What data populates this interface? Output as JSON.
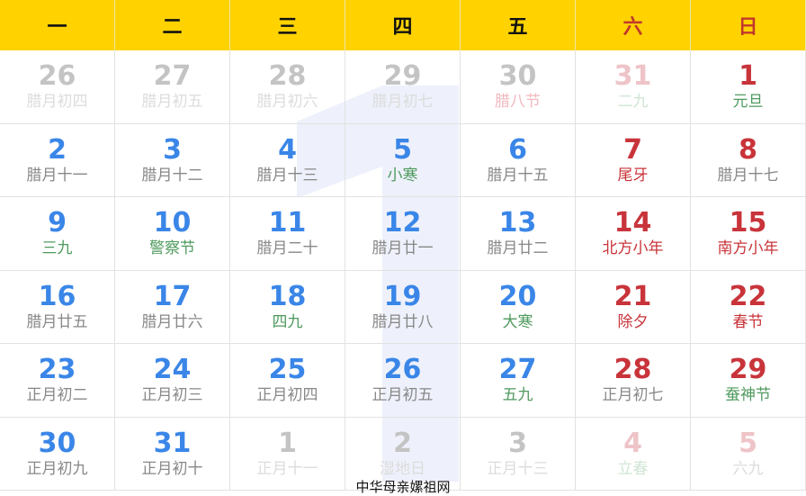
{
  "weekdays": [
    {
      "label": "一",
      "we": false
    },
    {
      "label": "二",
      "we": false
    },
    {
      "label": "三",
      "we": false
    },
    {
      "label": "四",
      "we": false
    },
    {
      "label": "五",
      "we": false
    },
    {
      "label": "六",
      "we": true
    },
    {
      "label": "日",
      "we": true
    }
  ],
  "watermark_month": "1",
  "colors": {
    "header": "#ffd200",
    "weekday_number": "#3a86e8",
    "weekend_number": "#c8343a",
    "term": "#4f9a5e"
  },
  "cells": [
    {
      "d": "26",
      "s": "腊月初四",
      "o": true
    },
    {
      "d": "27",
      "s": "腊月初五",
      "o": true
    },
    {
      "d": "28",
      "s": "腊月初六",
      "o": true
    },
    {
      "d": "29",
      "s": "腊月初七",
      "o": true
    },
    {
      "d": "30",
      "s": "腊八节",
      "o": true,
      "t": "hol"
    },
    {
      "d": "31",
      "s": "二九",
      "o": true,
      "t": "term"
    },
    {
      "d": "1",
      "s": "元旦",
      "t": "term"
    },
    {
      "d": "2",
      "s": "腊月十一"
    },
    {
      "d": "3",
      "s": "腊月十二"
    },
    {
      "d": "4",
      "s": "腊月十三"
    },
    {
      "d": "5",
      "s": "小寒",
      "t": "term"
    },
    {
      "d": "6",
      "s": "腊月十五"
    },
    {
      "d": "7",
      "s": "尾牙",
      "t": "hol"
    },
    {
      "d": "8",
      "s": "腊月十七"
    },
    {
      "d": "9",
      "s": "三九",
      "t": "term"
    },
    {
      "d": "10",
      "s": "警察节",
      "t": "term"
    },
    {
      "d": "11",
      "s": "腊月二十"
    },
    {
      "d": "12",
      "s": "腊月廿一"
    },
    {
      "d": "13",
      "s": "腊月廿二"
    },
    {
      "d": "14",
      "s": "北方小年",
      "t": "hol"
    },
    {
      "d": "15",
      "s": "南方小年",
      "t": "hol"
    },
    {
      "d": "16",
      "s": "腊月廿五"
    },
    {
      "d": "17",
      "s": "腊月廿六"
    },
    {
      "d": "18",
      "s": "四九",
      "t": "term"
    },
    {
      "d": "19",
      "s": "腊月廿八"
    },
    {
      "d": "20",
      "s": "大寒",
      "t": "term"
    },
    {
      "d": "21",
      "s": "除夕",
      "t": "hol"
    },
    {
      "d": "22",
      "s": "春节",
      "t": "hol"
    },
    {
      "d": "23",
      "s": "正月初二"
    },
    {
      "d": "24",
      "s": "正月初三"
    },
    {
      "d": "25",
      "s": "正月初四"
    },
    {
      "d": "26",
      "s": "正月初五"
    },
    {
      "d": "27",
      "s": "五九",
      "t": "term"
    },
    {
      "d": "28",
      "s": "正月初七"
    },
    {
      "d": "29",
      "s": "蚕神节",
      "t": "term"
    },
    {
      "d": "30",
      "s": "正月初九"
    },
    {
      "d": "31",
      "s": "正月初十"
    },
    {
      "d": "1",
      "s": "正月十一",
      "o": true
    },
    {
      "d": "2",
      "s": "湿地日",
      "o": true
    },
    {
      "d": "3",
      "s": "正月十三",
      "o": true
    },
    {
      "d": "4",
      "s": "立春",
      "o": true,
      "t": "term"
    },
    {
      "d": "5",
      "s": "六九",
      "o": true
    }
  ],
  "footer": "中华母亲嫘祖网"
}
